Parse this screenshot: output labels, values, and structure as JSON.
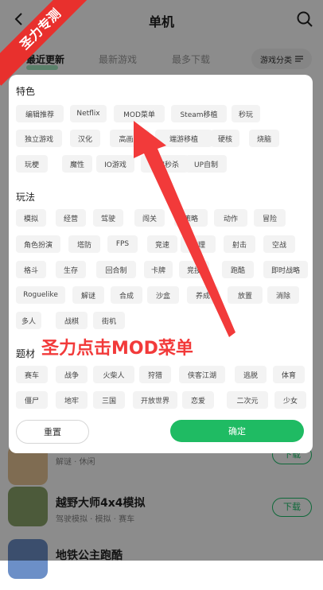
{
  "header": {
    "title": "单机"
  },
  "tabs": [
    {
      "label": "最近更新",
      "active": true
    },
    {
      "label": "最新游戏",
      "active": false
    },
    {
      "label": "最多下载",
      "active": false
    }
  ],
  "filter_button": {
    "label": "游戏分类"
  },
  "background_list": [
    {
      "tags": "解谜 · 休闲",
      "download": "下载"
    },
    {
      "name": "越野大师4x4模拟",
      "tags": "驾驶模拟 · 模拟 · 赛车",
      "download": "下载"
    },
    {
      "name": "地铁公主跑酷"
    }
  ],
  "panel": {
    "sections": [
      {
        "title": "特色",
        "chips": [
          "编辑推荐",
          "Netflix",
          "MOD菜单",
          "Steam移植",
          "秒玩",
          "独立游戏",
          "汉化",
          "高画质",
          "端游移植",
          "硬核",
          "烧脑",
          "玩梗",
          "魔性",
          "IO游戏",
          "一刀秒杀",
          "UP自制"
        ]
      },
      {
        "title": "玩法",
        "chips": [
          "模拟",
          "经营",
          "驾驶",
          "闯关",
          "策略",
          "动作",
          "冒险",
          "角色扮演",
          "塔防",
          "FPS",
          "竞速",
          "推理",
          "射击",
          "空战",
          "格斗",
          "生存",
          "回合制",
          "卡牌",
          "竞技",
          "跑酷",
          "即时战略",
          "Roguelike",
          "解谜",
          "合成",
          "沙盒",
          "养成",
          "放置",
          "消除",
          "多人",
          "战棋",
          "街机"
        ]
      },
      {
        "title": "题材",
        "chips": [
          "赛车",
          "战争",
          "火柴人",
          "狩猎",
          "侠客江湖",
          "逃脱",
          "体育",
          "僵尸",
          "地牢",
          "三国",
          "开放世界",
          "恋爱",
          "二次元",
          "少女"
        ]
      }
    ],
    "reset_label": "重置",
    "confirm_label": "确定"
  },
  "annotation": {
    "text": "圣力点击MOD菜单",
    "ribbon": "圣力专测",
    "color": "#f23a3a"
  },
  "colors": {
    "accent": "#1fbb63",
    "annotation_red": "#e8302d"
  }
}
